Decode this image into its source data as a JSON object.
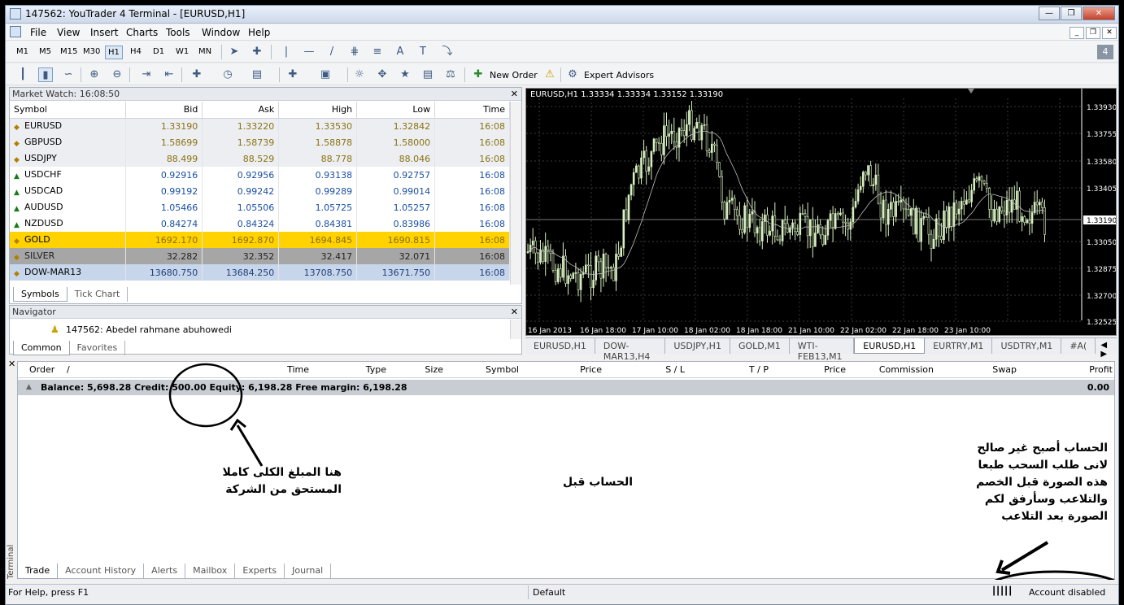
{
  "window": {
    "title": "147562: YouTrader 4 Terminal - [EURUSD,H1]"
  },
  "menu": [
    "File",
    "View",
    "Insert",
    "Charts",
    "Tools",
    "Window",
    "Help"
  ],
  "timeframes": [
    "M1",
    "M5",
    "M15",
    "M30",
    "H1",
    "H4",
    "D1",
    "W1",
    "MN"
  ],
  "toolbar": {
    "new_order": "New Order",
    "expert_advisors": "Expert Advisors"
  },
  "market_watch": {
    "title": "Market Watch: 16:08:50",
    "headers": [
      "Symbol",
      "Bid",
      "Ask",
      "High",
      "Low",
      "Time"
    ],
    "rows": [
      {
        "symbol": "EURUSD",
        "bid": "1.33190",
        "ask": "1.33220",
        "high": "1.33530",
        "low": "1.32842",
        "time": "16:08",
        "dir": "down"
      },
      {
        "symbol": "GBPUSD",
        "bid": "1.58699",
        "ask": "1.58739",
        "high": "1.58878",
        "low": "1.58000",
        "time": "16:08",
        "dir": "down"
      },
      {
        "symbol": "USDJPY",
        "bid": "88.499",
        "ask": "88.529",
        "high": "88.778",
        "low": "88.046",
        "time": "16:08",
        "dir": "down"
      },
      {
        "symbol": "USDCHF",
        "bid": "0.92916",
        "ask": "0.92956",
        "high": "0.93138",
        "low": "0.92757",
        "time": "16:08",
        "dir": "up"
      },
      {
        "symbol": "USDCAD",
        "bid": "0.99192",
        "ask": "0.99242",
        "high": "0.99289",
        "low": "0.99014",
        "time": "16:08",
        "dir": "up"
      },
      {
        "symbol": "AUDUSD",
        "bid": "1.05466",
        "ask": "1.05506",
        "high": "1.05725",
        "low": "1.05257",
        "time": "16:08",
        "dir": "up"
      },
      {
        "symbol": "NZDUSD",
        "bid": "0.84274",
        "ask": "0.84324",
        "high": "0.84381",
        "low": "0.83986",
        "time": "16:08",
        "dir": "up"
      },
      {
        "symbol": "GOLD",
        "bid": "1692.170",
        "ask": "1692.870",
        "high": "1694.845",
        "low": "1690.815",
        "time": "16:08",
        "dir": "gold"
      },
      {
        "symbol": "SILVER",
        "bid": "32.282",
        "ask": "32.352",
        "high": "32.417",
        "low": "32.071",
        "time": "16:08",
        "dir": "silver"
      },
      {
        "symbol": "DOW-MAR13",
        "bid": "13680.750",
        "ask": "13684.250",
        "high": "13708.750",
        "low": "13671.750",
        "time": "16:08",
        "dir": "dow"
      }
    ],
    "tabs": [
      "Symbols",
      "Tick Chart"
    ]
  },
  "navigator": {
    "title": "Navigator",
    "account": "147562: Abedel rahmane  abuhowedi",
    "tabs": [
      "Common",
      "Favorites"
    ]
  },
  "chart": {
    "info": "EURUSD,H1  1.33334 1.33334 1.33152 1.33190",
    "price_labels": [
      "1.33930",
      "1.33755",
      "1.33580",
      "1.33405",
      "1.33190",
      "1.33050",
      "1.32875",
      "1.32700",
      "1.32525"
    ],
    "time_labels": [
      "16 Jan 2013",
      "16 Jan 18:00",
      "17 Jan 10:00",
      "18 Jan 02:00",
      "18 Jan 18:00",
      "21 Jan 10:00",
      "22 Jan 02:00",
      "22 Jan 18:00",
      "23 Jan 10:00"
    ],
    "tabs": [
      "EURUSD,H1",
      "DOW-MAR13,H4",
      "USDJPY,H1",
      "GOLD,M1",
      "WTI-FEB13,M1",
      "EURUSD,H1",
      "EURTRY,M1",
      "USDTRY,M1",
      "#A("
    ],
    "colors": {
      "bg": "#000000",
      "candle": "#d8f0c0",
      "grid": "#3a3a3a",
      "text": "#ffffff"
    }
  },
  "terminal": {
    "headers": [
      "Order",
      "/",
      "Time",
      "Type",
      "Size",
      "Symbol",
      "Price",
      "S / L",
      "T / P",
      "Price",
      "Commission",
      "Swap",
      "Profit"
    ],
    "balance_line": "Balance: 5,698.28  Credit: 500.00  Equity: 6,198.28  Free margin: 6,198.28",
    "profit_total": "0.00",
    "tabs": [
      "Trade",
      "Account History",
      "Alerts",
      "Mailbox",
      "Experts",
      "Journal"
    ],
    "side_label": "Terminal"
  },
  "status": {
    "help": "For Help, press F1",
    "profile": "Default",
    "account": "Account disabled"
  },
  "annotations": {
    "left": [
      "هنا المبلغ الكلى كاملا",
      "المستحق من الشركة"
    ],
    "center": "الحساب قبل",
    "right": [
      "الحساب أصبح غير صالح",
      "لانى طلب السحب طبعا",
      "هذه الصورة قبل الخصم",
      "والتلاعب وسأرفق لكم",
      "الصورة بعد التلاعب"
    ]
  }
}
